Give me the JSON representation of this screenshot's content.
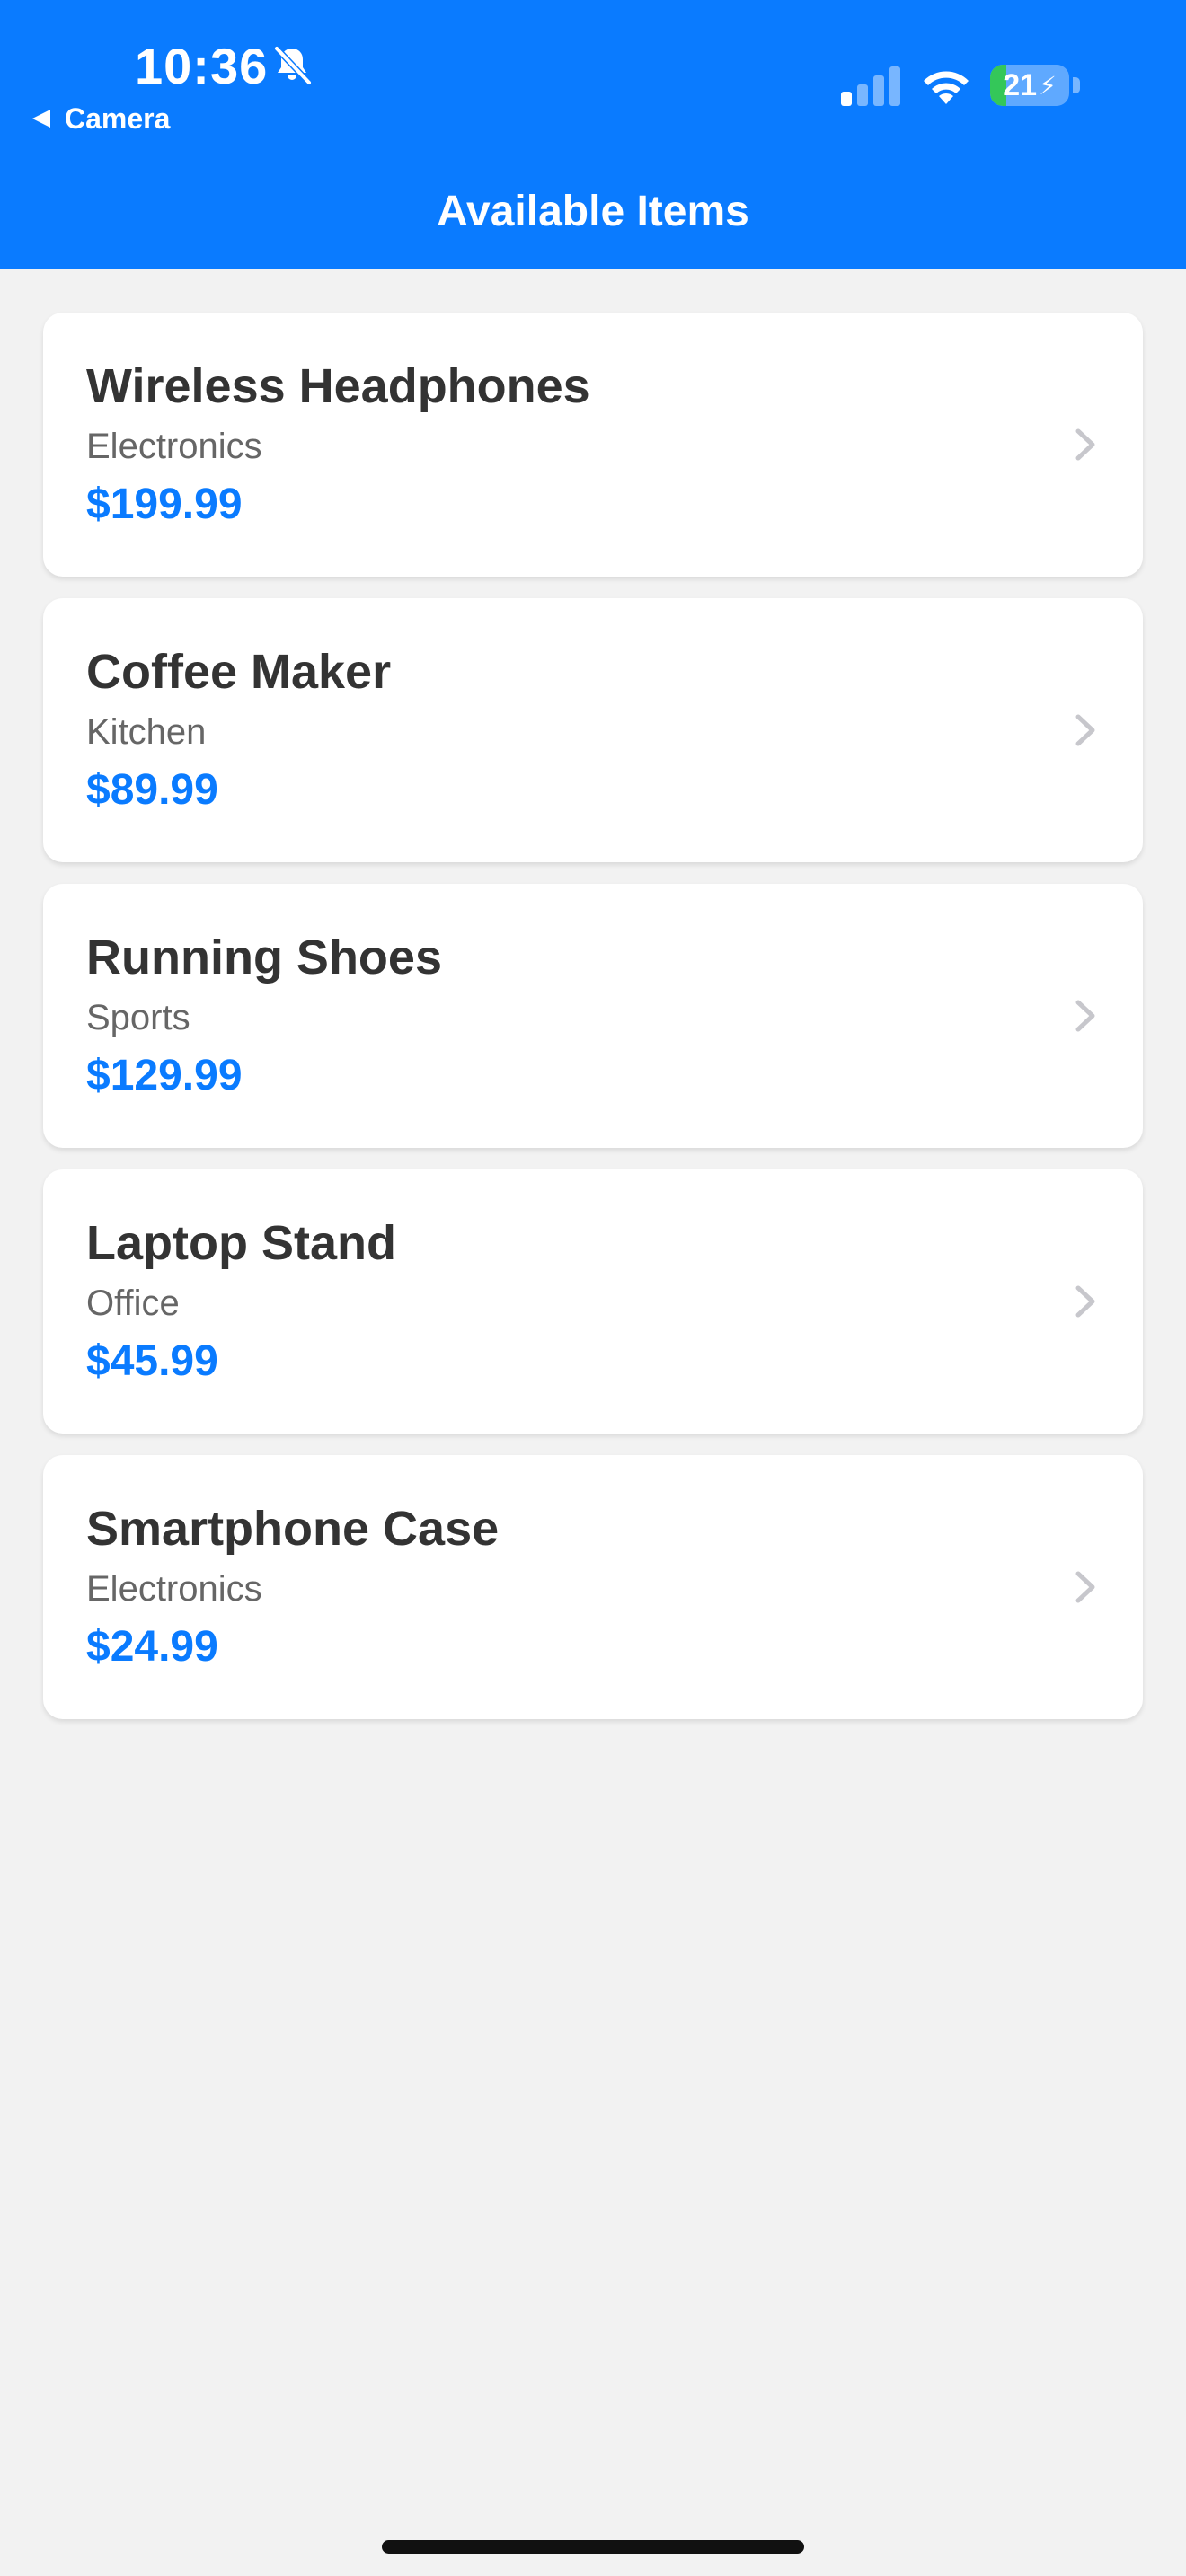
{
  "status_bar": {
    "time": "10:36",
    "battery_level": "21",
    "battery_fraction": 0.21,
    "icons": [
      "bell-slash-icon",
      "signal-icon",
      "wifi-icon",
      "battery-icon",
      "charging-bolt-icon"
    ]
  },
  "nav": {
    "back_label": "Camera",
    "title": "Available Items"
  },
  "colors": {
    "header_bg": "#0a7bff",
    "accent": "#0a7bff",
    "page_bg": "#f2f2f2",
    "card_bg": "#ffffff",
    "name_text": "#333333",
    "category_text": "#666666",
    "chevron": "#c7c7cc",
    "battery_green": "#34c759"
  },
  "items": [
    {
      "name": "Wireless Headphones",
      "category": "Electronics",
      "price": "$199.99"
    },
    {
      "name": "Coffee Maker",
      "category": "Kitchen",
      "price": "$89.99"
    },
    {
      "name": "Running Shoes",
      "category": "Sports",
      "price": "$129.99"
    },
    {
      "name": "Laptop Stand",
      "category": "Office",
      "price": "$45.99"
    },
    {
      "name": "Smartphone Case",
      "category": "Electronics",
      "price": "$24.99"
    }
  ]
}
